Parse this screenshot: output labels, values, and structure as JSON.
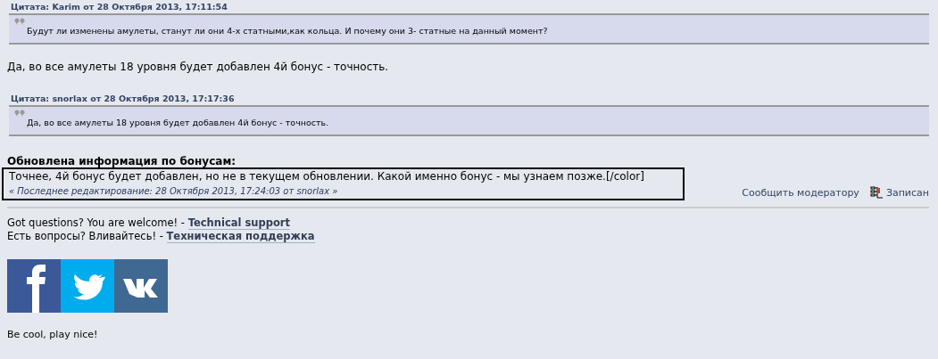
{
  "quotes_top": {
    "header": "Цитата: Karim от 28 Октября 2013, 17:11:54",
    "text": "Будут ли изменены амулеты, станут ли они 4-х статными,как кольца. И почему они 3- статные на данный момент?"
  },
  "reply": "Да, во все амулеты 18 уровня будет добавлен 4й бонус - точность.",
  "quote_second": {
    "header": "Цитата: snorlax от 28 Октября 2013, 17:17:36",
    "text": "Да, во все амулеты 18 уровня будет добавлен 4й бонус - точность."
  },
  "update_heading": "Обновлена информация по бонусам:",
  "update_text": "Точнее, 4й бонус будет добавлен, но не в текущем обновлении. Какой именно бонус - мы узнаем позже.[/color]",
  "last_edit": "« Последнее редактирование: 28 Октября 2013, 17:24:03 от snorlax »",
  "actions": {
    "report": "Сообщить модератору",
    "logged": "Записан"
  },
  "signature": {
    "lines": [
      {
        "text": "Got questions? You are welcome! - ",
        "link": "Technical support"
      },
      {
        "text": "Есть вопросы? Вливайтесь! - ",
        "link": "Техническая поддержка"
      }
    ],
    "social": [
      {
        "kind": "facebook",
        "color": "#3b5998"
      },
      {
        "kind": "twitter",
        "color": "#00acee"
      },
      {
        "kind": "vk",
        "color": "#3f6892"
      }
    ],
    "motto": "Be cool, play nice!"
  }
}
